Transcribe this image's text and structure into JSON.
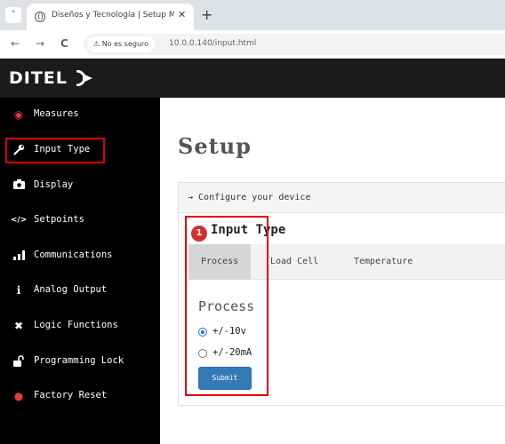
{
  "browser": {
    "menu_icon": "˅",
    "tab_title": "Diseños y Tecnología | Setup M",
    "tab_close": "✕",
    "new_tab": "+",
    "back": "←",
    "forward": "→",
    "reload": "C",
    "security_label": "⚠ No es seguro",
    "url": "10.0.0.140/input.html"
  },
  "brand": {
    "logo_text": "DITEL"
  },
  "sidebar": {
    "items": [
      {
        "icon": "gauge-icon",
        "glyph": "◉",
        "label": "Measures",
        "color": "#e53935"
      },
      {
        "icon": "wrench-icon",
        "glyph": "🔧",
        "label": "Input Type",
        "color": "#ffffff"
      },
      {
        "icon": "camera-icon",
        "glyph": "◘",
        "label": "Display",
        "color": "#ffffff"
      },
      {
        "icon": "code-icon",
        "glyph": "</>",
        "label": "Setpoints",
        "color": "#ffffff"
      },
      {
        "icon": "signal-icon",
        "glyph": "▁▃▅",
        "label": "Communications",
        "color": "#ffffff"
      },
      {
        "icon": "info-icon",
        "glyph": "i",
        "label": "Analog Output",
        "color": "#ffffff"
      },
      {
        "icon": "cross-icon",
        "glyph": "✖",
        "label": "Logic Functions",
        "color": "#ffffff"
      },
      {
        "icon": "lock-icon",
        "glyph": "🔓",
        "label": "Programming Lock",
        "color": "#ffffff"
      },
      {
        "icon": "warning-icon",
        "glyph": "●",
        "label": "Factory Reset",
        "color": "#e53935"
      }
    ]
  },
  "main": {
    "title": "Setup",
    "panel_heading": "→ Configure your device",
    "badge": "1",
    "section_title": "Input Type",
    "tabs": [
      "Process",
      "Load Cell",
      "Temperature"
    ],
    "form_title": "Process",
    "options": [
      {
        "label": "+/-10v",
        "checked": true
      },
      {
        "label": "+/-20mA",
        "checked": false
      }
    ],
    "submit_label": "Submit"
  },
  "colors": {
    "highlight": "#e00000",
    "submit": "#337ab7",
    "sidebar_bg": "#000000"
  }
}
